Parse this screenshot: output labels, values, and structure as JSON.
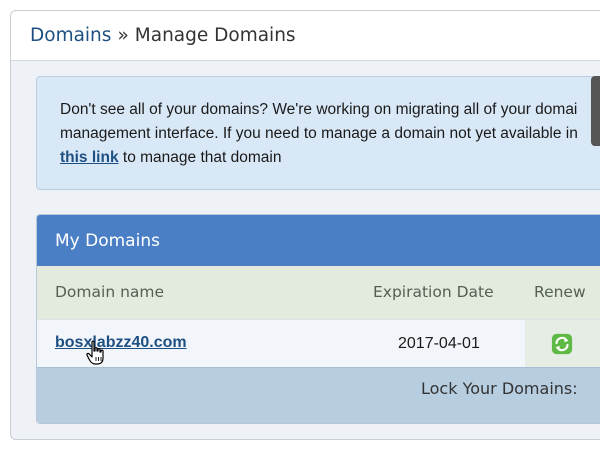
{
  "breadcrumb": {
    "root": "Domains",
    "separator": "»",
    "current": "Manage Domains"
  },
  "info_message": {
    "line1": "Don't see all of your domains? We're working on migrating all of your domai",
    "line2": "management interface. If you need to manage a domain not yet available in",
    "link": "this link",
    "line3_rest": " to manage that domain"
  },
  "panel": {
    "title": "My Domains",
    "columns": {
      "domain_name": "Domain name",
      "expiration_date": "Expiration Date",
      "renew": "Renew"
    },
    "rows": [
      {
        "domain": "bosxlabzz40.com",
        "expiration": "2017-04-01",
        "renew_icon": "refresh-icon"
      }
    ],
    "footer_label": "Lock Your Domains:"
  },
  "colors": {
    "header_blue": "#4a7fc6",
    "link_blue": "#1e4f82",
    "info_bg": "#d9e8f6",
    "table_head_bg": "#e3ebdf",
    "renew_green": "#4caf3c"
  },
  "cursor": "hand-pointer-icon"
}
